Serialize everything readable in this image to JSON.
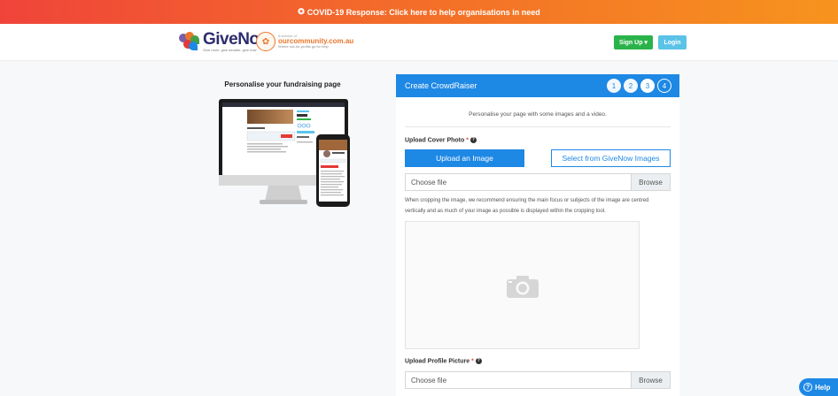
{
  "banner": {
    "icon": "virus-icon",
    "text": "COVID-19 Response: Click here to help organisations in need"
  },
  "header": {
    "logo_name": "GiveNow",
    "logo_tagline": "Give more, give smarter, give now",
    "partner_small": "A service of",
    "partner_name": "ourcommunity.com.au",
    "partner_tagline": "Where not-for-profits go for help",
    "signup_label": "Sign Up ▾",
    "login_label": "Login"
  },
  "left": {
    "title": "Personalise your fundraising page"
  },
  "panel": {
    "title": "Create CrowdRaiser",
    "steps": [
      "1",
      "2",
      "3",
      "4"
    ],
    "intro": "Personalise your page with some images and a video.",
    "cover_label": "Upload Cover Photo",
    "required_mark": "*",
    "upload_btn": "Upload an Image",
    "select_btn": "Select from GiveNow Images",
    "cover_file": "Choose file",
    "browse": "Browse",
    "crop_help": "When cropping the image, we recommend ensuring the main focus or subjects of the image are centred vertically and as much of your image as possible is displayed within the cropping tool.",
    "profile_label": "Upload Profile Picture",
    "profile_file": "Choose file"
  },
  "help": {
    "label": "Help"
  },
  "colors": {
    "primary": "#1e88e5",
    "signup": "#2ab34a",
    "login": "#5bc3e8",
    "banner_start": "#f0443a",
    "banner_end": "#f7931e"
  }
}
